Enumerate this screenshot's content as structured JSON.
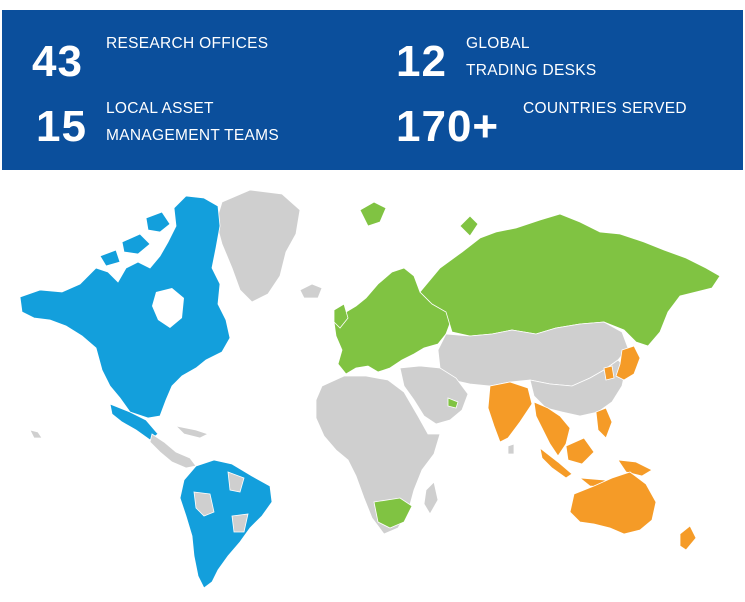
{
  "stats": {
    "research": {
      "number": "43",
      "label": "RESEARCH OFFICES"
    },
    "trading": {
      "number": "12",
      "label_line1": "GLOBAL",
      "label_line2": "TRADING DESKS"
    },
    "local_teams": {
      "number": "15",
      "label_line1": "LOCAL ASSET",
      "label_line2": "MANAGEMENT TEAMS"
    },
    "countries": {
      "number": "170+",
      "label": "COUNTRIES SERVED"
    }
  },
  "colors": {
    "banner": "#0b4f9c",
    "americas": "#139fdc",
    "emea": "#80c342",
    "asia_pacific": "#f59b27",
    "other": "#cfcfcf"
  }
}
